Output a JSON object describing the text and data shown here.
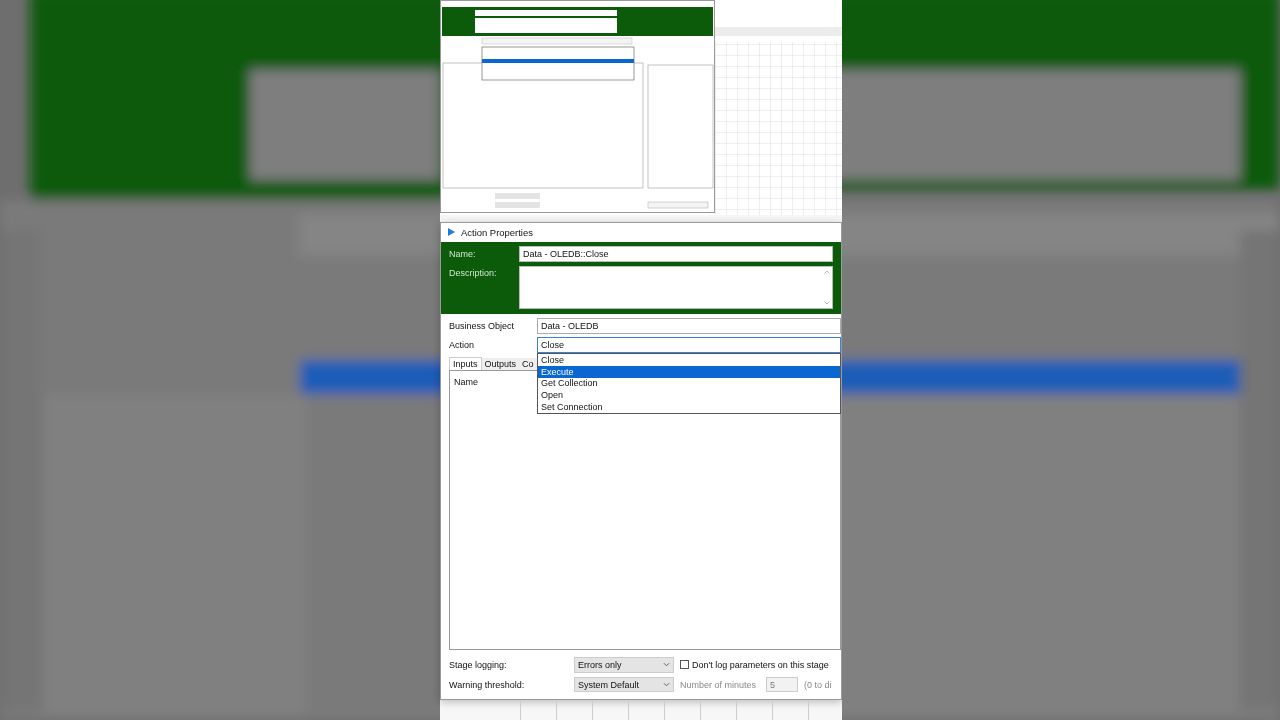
{
  "dialog": {
    "title": "Action Properties",
    "name_label": "Name:",
    "name_value": "Data - OLEDB::Close",
    "description_label": "Description:",
    "business_object_label": "Business Object",
    "business_object_value": "Data - OLEDB",
    "action_label": "Action",
    "action_value": "Close",
    "action_options": [
      {
        "label": "Close",
        "selected": false
      },
      {
        "label": "Execute",
        "selected": true
      },
      {
        "label": "Get Collection",
        "selected": false
      },
      {
        "label": "Open",
        "selected": false
      },
      {
        "label": "Set Connection",
        "selected": false
      }
    ],
    "tabs": [
      {
        "label": "Inputs",
        "selected": true
      },
      {
        "label": "Outputs",
        "selected": false
      },
      {
        "label": "Co",
        "selected": false
      }
    ],
    "column_header": "Name",
    "stage_logging_label": "Stage logging:",
    "stage_logging_value": "Errors only",
    "dont_log": {
      "label": "Don't log parameters on this stage",
      "checked": false
    },
    "warning_label": "Warning threshold:",
    "warning_value": "System Default",
    "minutes_label": "Number of minutes",
    "minutes_value": "5",
    "disable_hint": "(0 to di"
  }
}
